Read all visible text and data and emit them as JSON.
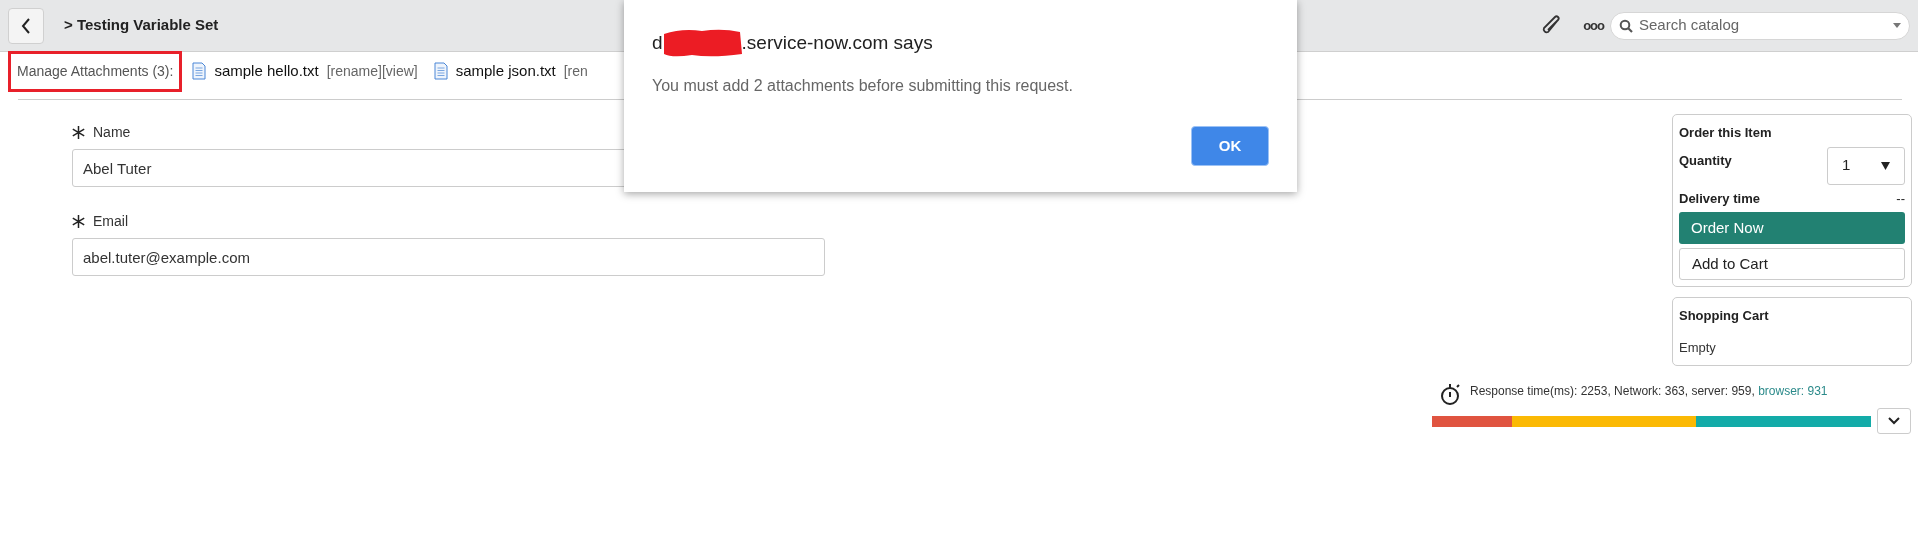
{
  "header": {
    "title": "> Testing Variable Set",
    "search": {
      "placeholder": "Search catalog"
    },
    "more_label": "ooo"
  },
  "attachments": {
    "label": "Manage Attachments (3):",
    "highlighted": true,
    "files": [
      {
        "name": "sample hello.txt",
        "actions": "[rename][view]"
      },
      {
        "name": "sample json.txt",
        "actions": "[ren"
      }
    ]
  },
  "form": {
    "fields": [
      {
        "label": "Name",
        "required": true,
        "value": "Abel Tuter"
      },
      {
        "label": "Email",
        "required": true,
        "value": "abel.tuter@example.com"
      }
    ]
  },
  "order_panel": {
    "title": "Order this Item",
    "quantity_label": "Quantity",
    "quantity_value": "1",
    "delivery_label": "Delivery time",
    "delivery_value": "--",
    "primary_button": "Order Now",
    "secondary_button": "Add to Cart"
  },
  "cart": {
    "title": "Shopping Cart",
    "status": "Empty"
  },
  "response_time": {
    "text": "Response time(ms): 2253, Network: 363, server: 959, ",
    "browser": "browser: 931"
  },
  "dialog": {
    "title_prefix": "d",
    "title_suffix": ".service-now.com says",
    "message": "You must add 2 attachments before submitting this request.",
    "button": "OK"
  }
}
